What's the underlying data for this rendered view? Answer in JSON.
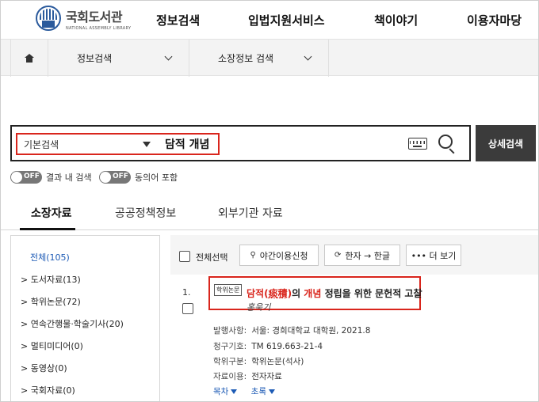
{
  "header": {
    "logo_ko": "국회도서관",
    "logo_en": "NATIONAL ASSEMBLY LIBRARY",
    "menu": [
      "정보검색",
      "입법지원서비스",
      "책이야기",
      "이용자마당"
    ]
  },
  "subnav": {
    "level1": "정보검색",
    "level2": "소장정보 검색"
  },
  "search": {
    "mode": "기본검색",
    "query": "담적 개념",
    "advanced_label": "상세검색"
  },
  "options": {
    "within_results": "결과 내 검색",
    "synonyms": "동의어 포함",
    "toggle_state": "OFF"
  },
  "tabs": [
    "소장자료",
    "공공정책정보",
    "외부기관 자료"
  ],
  "facets": [
    "전체(105)",
    "> 도서자료(13)",
    "> 학위논문(72)",
    "> 연속간행물·학술기사(20)",
    "> 멀티미디어(0)",
    "> 동영상(0)",
    "> 국회자료(0)"
  ],
  "toolbar": {
    "select_all": "전체선택",
    "night_use": "야간이용신청",
    "hanja": "한자 → 한글",
    "more": "••• 더 보기"
  },
  "result": {
    "number": "1.",
    "badge": "학위논문",
    "title_parts": {
      "p1": "담적(",
      "p2": "痰積",
      "p3": ")",
      "p4": "의 ",
      "p5": "개념",
      "p6": " 정립을 위한 문헌적 고찰"
    },
    "author": "홍욱기",
    "meta": [
      {
        "key": "발행사항:",
        "value": "서울: 경희대학교 대학원, 2021.8"
      },
      {
        "key": "청구기호:",
        "value": "TM 619.663-21-4"
      },
      {
        "key": "학위구분:",
        "value": "학위논문(석사)"
      },
      {
        "key": "자료이용:",
        "value": "전자자료"
      }
    ],
    "links": [
      "목차",
      "초록"
    ]
  }
}
